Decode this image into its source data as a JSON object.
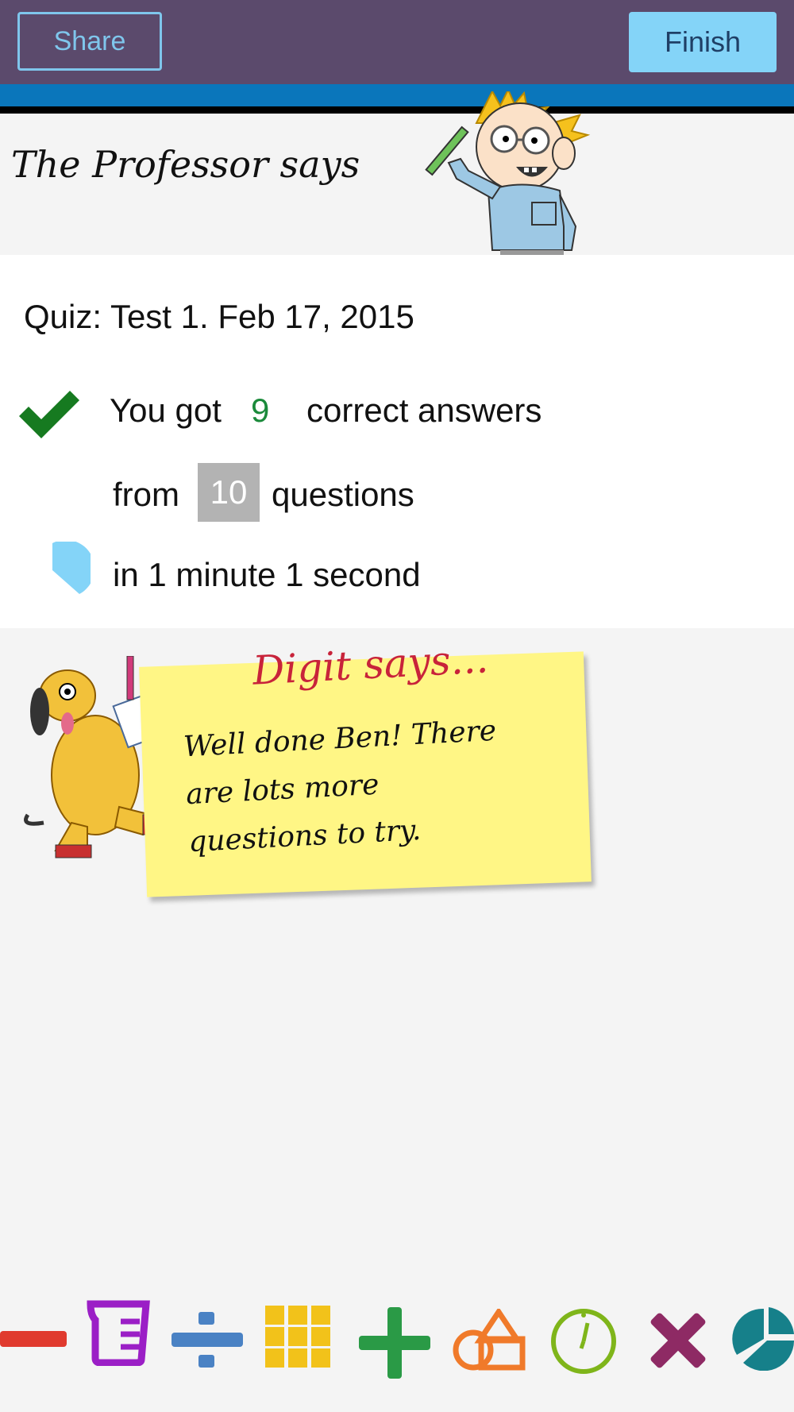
{
  "header": {
    "share_label": "Share",
    "finish_label": "Finish"
  },
  "professor": {
    "title": "The Professor says"
  },
  "result": {
    "quiz_title": "Quiz: Test 1. Feb 17, 2015",
    "you_got_label": "You got",
    "correct_count": "9",
    "correct_suffix": "correct answers",
    "from_label": "from",
    "total_count": "10",
    "questions_label": "questions",
    "time_text": "in 1 minute 1 second"
  },
  "digit": {
    "title": "Digit says...",
    "message": "Well done Ben! There are lots more questions to try."
  },
  "bottom_icons": [
    {
      "name": "subtract-icon",
      "color": "#e03a2e"
    },
    {
      "name": "measure-icon",
      "color": "#9b1fc6"
    },
    {
      "name": "divide-icon",
      "color": "#4a82c4"
    },
    {
      "name": "grid-icon",
      "color": "#f2c21a"
    },
    {
      "name": "add-icon",
      "color": "#2a9a46"
    },
    {
      "name": "shapes-icon",
      "color": "#f07a2a"
    },
    {
      "name": "clock-icon",
      "color": "#7fb51a"
    },
    {
      "name": "multiply-icon",
      "color": "#8e2a64"
    },
    {
      "name": "pie-chart-icon",
      "color": "#16808a"
    }
  ]
}
